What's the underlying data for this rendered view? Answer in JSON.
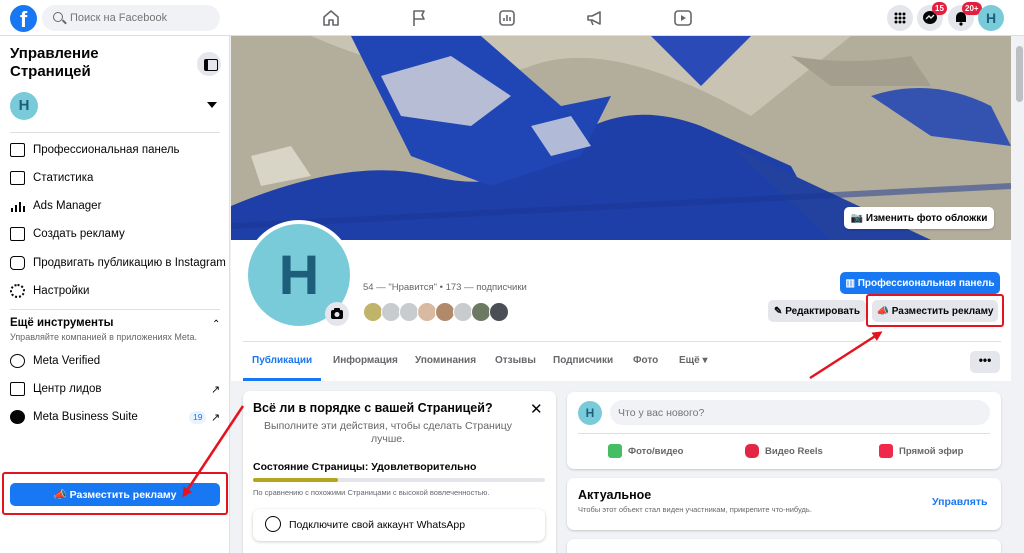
{
  "topbar": {
    "search_placeholder": "Поиск на Facebook",
    "messenger_badge": "15",
    "notifications_badge": "20+",
    "avatar_letter": "H",
    "nav_icons": [
      "home-icon",
      "flag-icon",
      "chart-icon",
      "megaphone-icon",
      "video-icon"
    ]
  },
  "sidebar": {
    "title": "Управление Страницей",
    "avatar_letter": "H",
    "items": [
      {
        "label": "Профессиональная панель",
        "icon": "dashboard-icon"
      },
      {
        "label": "Статистика",
        "icon": "stats-icon"
      },
      {
        "label": "Ads Manager",
        "icon": "bar-chart-icon"
      },
      {
        "label": "Создать рекламу",
        "icon": "pencil-icon"
      },
      {
        "label": "Продвигать публикацию в Instagram",
        "icon": "instagram-icon"
      },
      {
        "label": "Настройки",
        "icon": "gear-icon"
      }
    ],
    "more_tools_title": "Ещё инструменты",
    "more_tools_subtitle": "Управляйте компанией в приложениях Meta.",
    "tools": [
      {
        "label": "Meta Verified",
        "icon": "verified-icon",
        "external": false
      },
      {
        "label": "Центр лидов",
        "icon": "leads-icon",
        "external": true
      },
      {
        "label": "Meta Business Suite",
        "icon": "business-suite-icon",
        "external": true,
        "count": "19"
      }
    ],
    "external_glyph": "↗",
    "promote_label": "Разместить рекламу"
  },
  "cover": {
    "edit_label": "Изменить фото обложки"
  },
  "profile": {
    "avatar_letter": "H",
    "stats": "54 — \"Нравится\" • 173 — подписчики",
    "pro_panel_label": "Профессиональная панель",
    "edit_label": "Редактировать",
    "promote_label": "Разместить рекламу",
    "more_glyph": "•••"
  },
  "tabs": [
    "Публикации",
    "Информация",
    "Упоминания",
    "Отзывы",
    "Подписчики",
    "Фото",
    "Ещё ▾"
  ],
  "checklist": {
    "title": "Всё ли в порядке с вашей Страницей?",
    "subtitle": "Выполните эти действия, чтобы сделать Страницу лучше.",
    "close_glyph": "✕",
    "state_label": "Состояние Страницы: Удовлетворительно",
    "progress": 0.29,
    "progress_color": "#b7a51b",
    "comparison": "По сравнению с похожими Страницами с высокой вовлеченностью.",
    "whatsapp_label": "Подключите свой аккаунт WhatsApp"
  },
  "composer": {
    "avatar_letter": "H",
    "placeholder": "Что у вас нового?",
    "actions": [
      {
        "label": "Фото/видео",
        "icon": "photo-icon",
        "color": "#45bd62"
      },
      {
        "label": "Видео Reels",
        "icon": "reels-icon",
        "color": "#e42645"
      },
      {
        "label": "Прямой эфир",
        "icon": "live-icon",
        "color": "#f02849"
      }
    ]
  },
  "featured": {
    "title": "Актуальное",
    "subtitle": "Чтобы этот объект стал виден участникам, прикрепите что-нибудь.",
    "manage_label": "Управлять"
  },
  "colors": {
    "brand": "#1877f2",
    "highlight": "#e4141e",
    "avatar": "#79cbd9"
  }
}
